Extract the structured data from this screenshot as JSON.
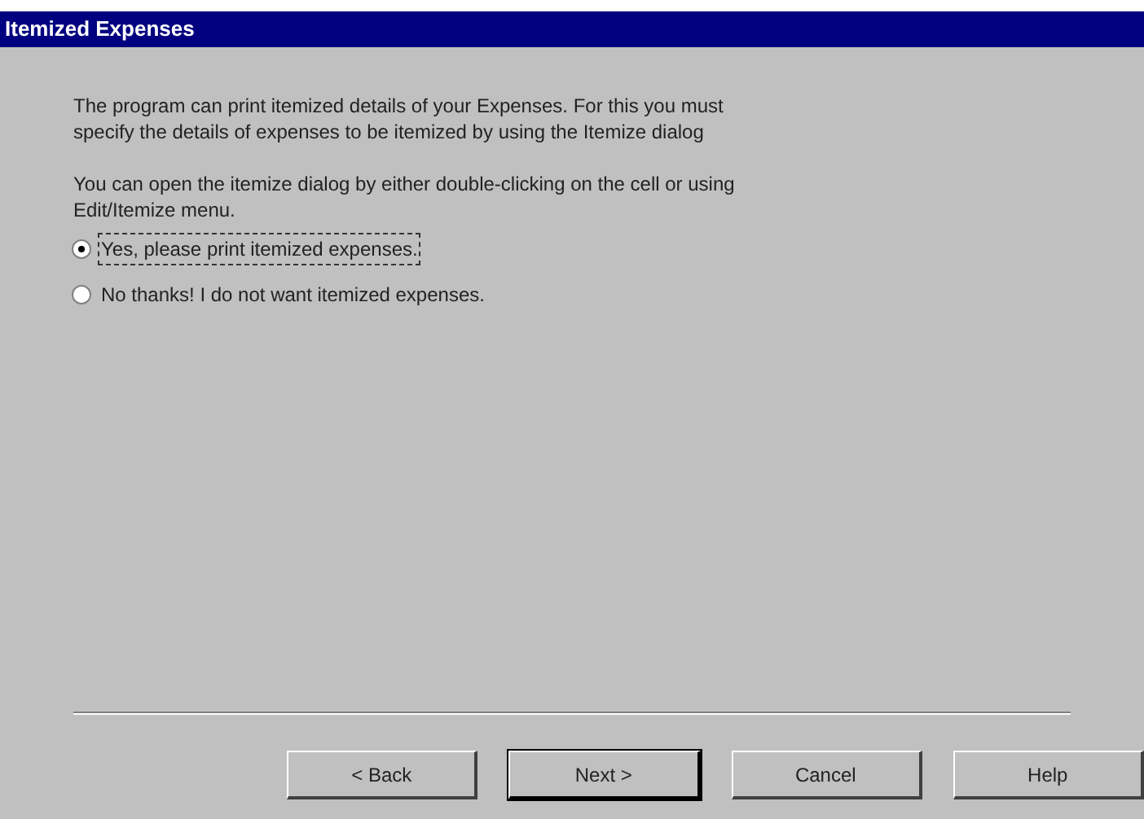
{
  "window": {
    "title": "Itemized Expenses"
  },
  "paragraphs": [
    "The program can print itemized details of your Expenses. For this you must specify the details of expenses to be itemized by using the Itemize dialog",
    "You can open the itemize dialog by either double-clicking on the cell or using Edit/Itemize menu."
  ],
  "options": [
    {
      "label": "Yes, please print itemized expenses.",
      "selected": true
    },
    {
      "label": "No thanks! I do not want itemized expenses.",
      "selected": false
    }
  ],
  "buttons": [
    {
      "label": "< Back",
      "default": false
    },
    {
      "label": "Next >",
      "default": true
    },
    {
      "label": "Cancel",
      "default": false
    },
    {
      "label": "Help",
      "default": false
    }
  ]
}
